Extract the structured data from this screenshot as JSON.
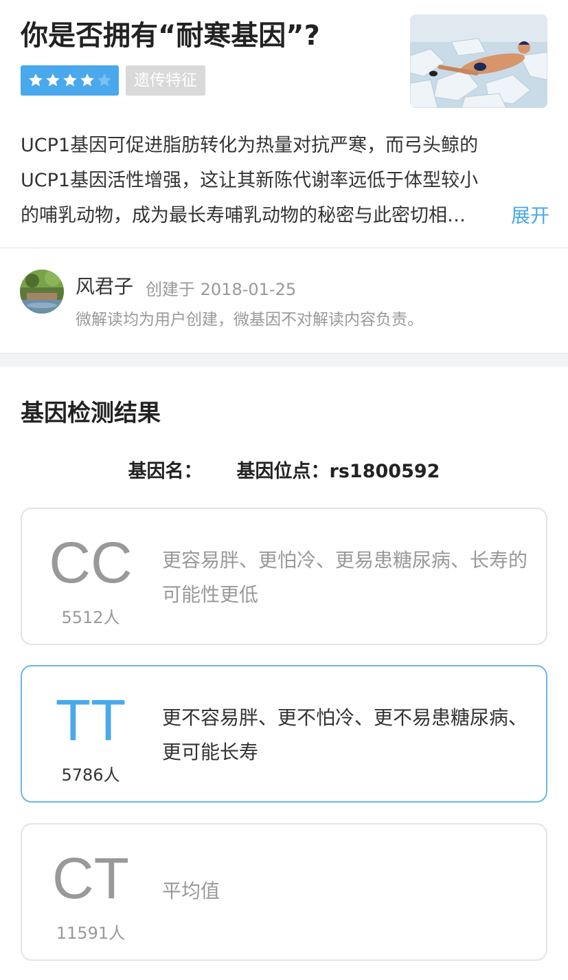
{
  "header": {
    "title": "你是否拥有“耐寒基因”?",
    "rating_stars": 4,
    "tag": "遗传特征",
    "description": "UCP1基因可促进脂肪转化为热量对抗严寒，而弓头鲸的UCP1基因活性增强，这让其新陈代谢率远低于体型较小的哺乳动物，成为最长寿哺乳动物的秘密与此密切相…",
    "expand_label": "展开"
  },
  "author": {
    "name": "风君子",
    "created_label": "创建于",
    "created_date": "2018-01-25",
    "disclaimer": "微解读均为用户创建，微基因不对解读内容负责。"
  },
  "results": {
    "section_title": "基因检测结果",
    "gene_name_label": "基因名：",
    "gene_site_label": "基因位点：",
    "gene_site_value": "rs1800592",
    "cards": [
      {
        "genotype": "CC",
        "count": "5512人",
        "effect": "更容易胖、更怕冷、更易患糖尿病、长寿的可能性更低"
      },
      {
        "genotype": "TT",
        "count": "5786人",
        "effect": "更不容易胖、更不怕冷、更不易患糖尿病、更可能长寿"
      },
      {
        "genotype": "CT",
        "count": "11591人",
        "effect": "平均值"
      }
    ]
  },
  "colors": {
    "accent": "#4aa8ec",
    "tag_bg": "#d9d9d9",
    "muted_text": "#999999",
    "active_border": "#6ab5e3"
  }
}
